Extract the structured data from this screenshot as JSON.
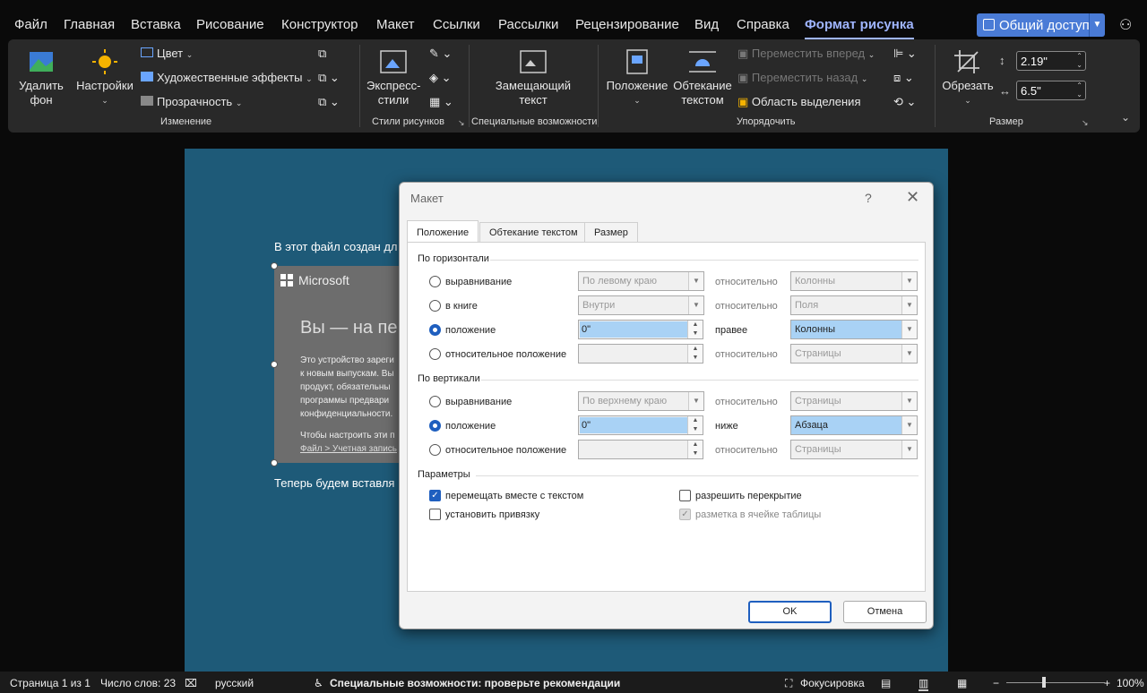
{
  "menu_tabs": [
    "Файл",
    "Главная",
    "Вставка",
    "Рисование",
    "Конструктор",
    "Макет",
    "Ссылки",
    "Рассылки",
    "Рецензирование",
    "Вид",
    "Справка",
    "Формат рисунка"
  ],
  "share_label": "Общий доступ",
  "ribbon": {
    "remove_bg": "Удалить фон",
    "corrections": "Настройки",
    "color": "Цвет",
    "artistic": "Художественные эффекты",
    "transparency": "Прозрачность",
    "group_change": "Изменение",
    "quick_styles": "Экспресс-стили",
    "group_styles": "Стили рисунков",
    "alt_text": "Замещающий текст",
    "group_access": "Специальные возможности",
    "position": "Положение",
    "wrap": "Обтекание текстом",
    "bring_forward": "Переместить вперед",
    "send_backward": "Переместить назад",
    "selection_pane": "Область выделения",
    "group_arrange": "Упорядочить",
    "crop": "Обрезать",
    "height": "2.19\"",
    "width": "6.5\"",
    "group_size": "Размер"
  },
  "doc": {
    "line1": "В этот файл создан дл",
    "line2": "Теперь будем вставля",
    "img_brand": "Microsoft",
    "img_heading": "Вы — на пе",
    "img_p1": "Это устройство зареги",
    "img_p2": "к новым выпускам. Вы",
    "img_p3": "продукт, обязательны",
    "img_p4": "программы предвари",
    "img_p5": "конфиденциальности.",
    "img_p6": "Чтобы настроить эти п",
    "img_p7": "Файл > Учетная запись"
  },
  "dialog": {
    "title": "Макет",
    "help": "?",
    "tabs": [
      "Положение",
      "Обтекание текстом",
      "Размер"
    ],
    "horizontal": "По горизонтали",
    "vertical": "По вертикали",
    "params": "Параметры",
    "h_rows": [
      {
        "label": "выравнивание",
        "value": "По левому краю",
        "mid": "относительно",
        "rel": "Колонны"
      },
      {
        "label": "в книге",
        "value": "Внутри",
        "mid": "относительно",
        "rel": "Поля"
      },
      {
        "label": "положение",
        "value": "0\"",
        "mid": "правее",
        "rel": "Колонны"
      },
      {
        "label": "относительное положение",
        "value": "",
        "mid": "относительно",
        "rel": "Страницы"
      }
    ],
    "v_rows": [
      {
        "label": "выравнивание",
        "value": "По верхнему краю",
        "mid": "относительно",
        "rel": "Страницы"
      },
      {
        "label": "положение",
        "value": "0\"",
        "mid": "ниже",
        "rel": "Абзаца"
      },
      {
        "label": "относительное положение",
        "value": "",
        "mid": "относительно",
        "rel": "Страницы"
      }
    ],
    "opt_move": "перемещать вместе с текстом",
    "opt_anchor": "установить привязку",
    "opt_overlap": "разрешить перекрытие",
    "opt_table": "разметка в ячейке таблицы",
    "ok": "OK",
    "cancel": "Отмена"
  },
  "status": {
    "page": "Страница 1 из 1",
    "words": "Число слов: 23",
    "lang": "русский",
    "access": "Специальные возможности: проверьте рекомендации",
    "focus": "Фокусировка",
    "zoom": "100%"
  }
}
